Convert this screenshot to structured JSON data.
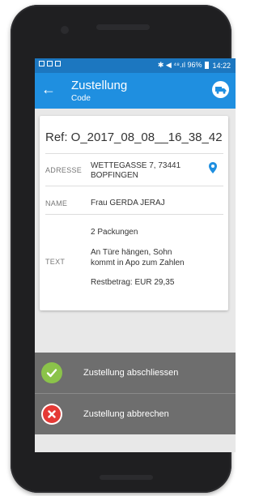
{
  "status_bar": {
    "right_text": "✱ ◀ ⁴⁸.ıl 96%",
    "time": "14:22"
  },
  "app_bar": {
    "title": "Zustellung",
    "subtitle": "Code",
    "back_icon": "arrow-left",
    "truck_icon": "truck"
  },
  "card": {
    "ref": "Ref: O_2017_08_08__16_38_42",
    "address_label": "ADRESSE",
    "address_line1": "WETTEGASSE 7, 73441",
    "address_line2": "BOPFINGEN",
    "name_label": "NAME",
    "name_value": "Frau GERDA JERAJ",
    "packages": "2 Packungen",
    "text_label": "TEXT",
    "text_line1": "An Türe hängen, Sohn",
    "text_line2": "kommt in Apo zum Zahlen",
    "rest_amount": "Restbetrag: EUR 29,35"
  },
  "actions": {
    "complete_label": "Zustellung abschliessen",
    "cancel_label": "Zustellung abbrechen"
  },
  "colors": {
    "status_bar": "#1c77c0",
    "app_bar": "#1f8fe0",
    "complete_icon": "#8bc34a",
    "cancel_icon": "#e53935",
    "action_bg": "#6e6e6e"
  }
}
